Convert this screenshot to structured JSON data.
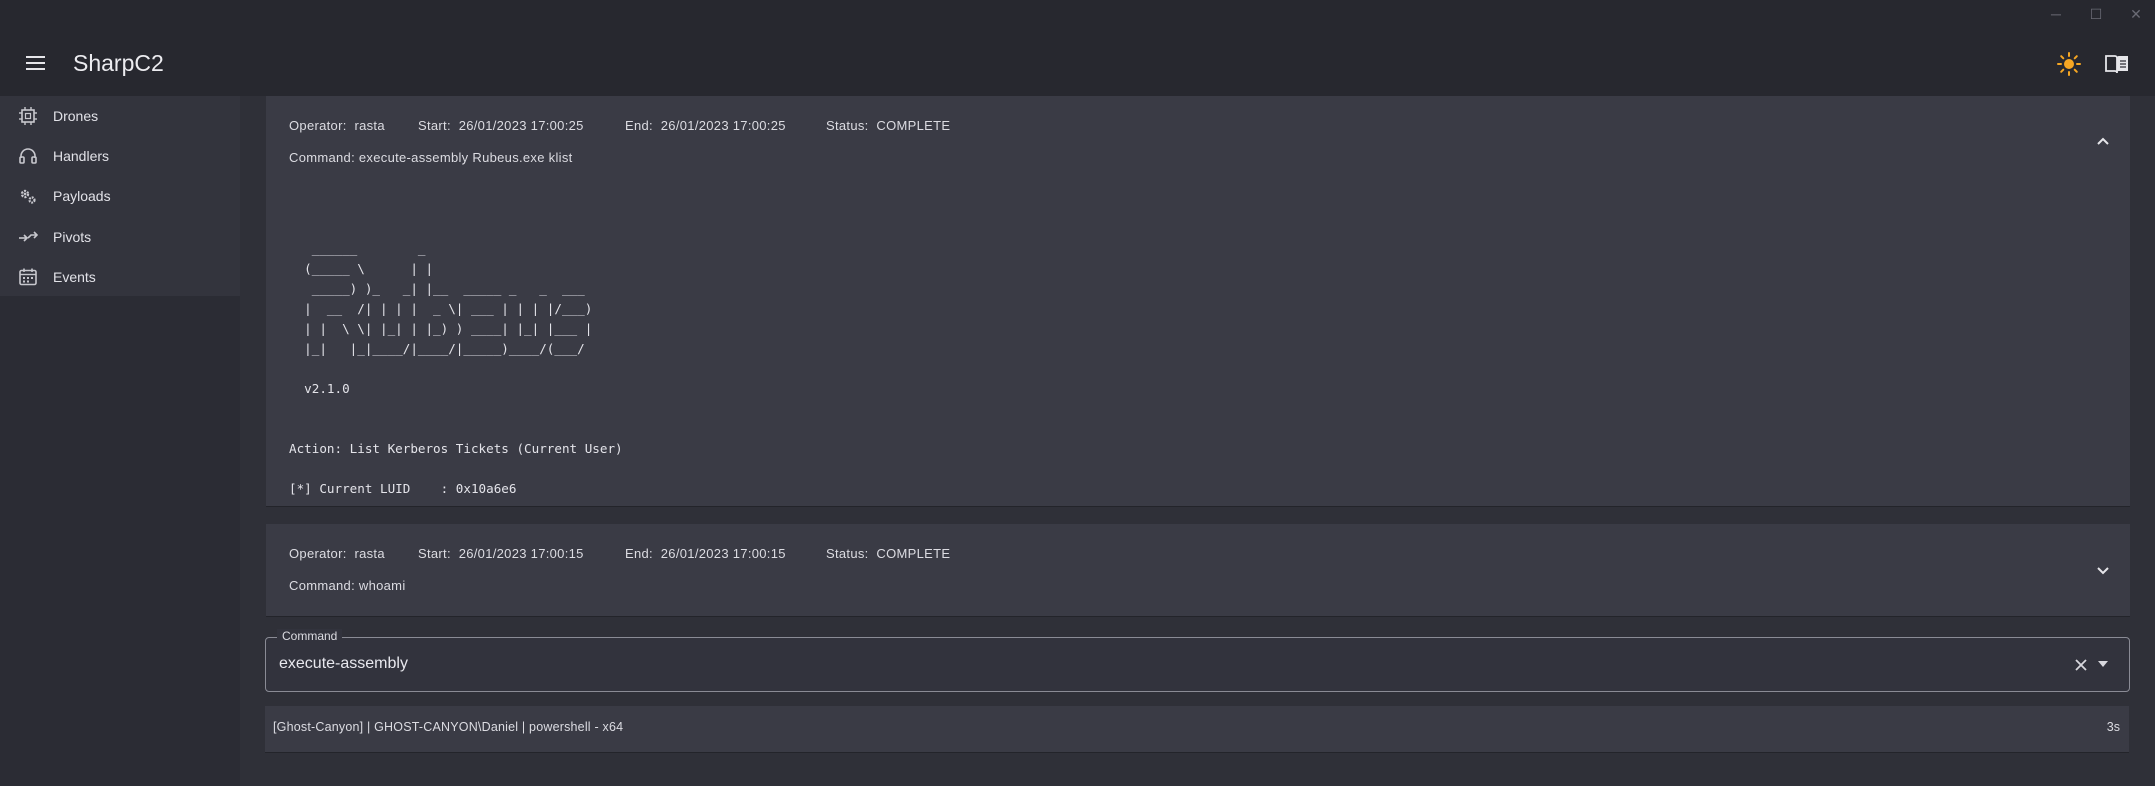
{
  "app": {
    "title": "SharpC2"
  },
  "sidebar": {
    "items": [
      {
        "label": "Drones",
        "icon": "chip-icon"
      },
      {
        "label": "Handlers",
        "icon": "headset-icon"
      },
      {
        "label": "Payloads",
        "icon": "gears-icon"
      },
      {
        "label": "Pivots",
        "icon": "pivot-icon"
      },
      {
        "label": "Events",
        "icon": "calendar-icon"
      }
    ]
  },
  "tasks": [
    {
      "operator_label": "Operator:",
      "operator": "rasta",
      "start_label": "Start:",
      "start": "26/01/2023 17:00:25",
      "end_label": "End:",
      "end": "26/01/2023 17:00:25",
      "status_label": "Status:",
      "status": "COMPLETE",
      "command_label": "Command:",
      "command": "execute-assembly Rubeus.exe klist",
      "expanded": true,
      "output": "\n\n   ______        _\n  (_____ \\      | |\n   _____) )_   _| |__  _____ _   _  ___\n  |  __  /| | | |  _ \\| ___ | | | |/___)\n  | |  \\ \\| |_| | |_) ) ____| |_| |___ |\n  |_|   |_|____/|____/|_____)____/(___/\n\n  v2.1.0\n\n\nAction: List Kerberos Tickets (Current User)\n\n[*] Current LUID    : 0x10a6e6"
    },
    {
      "operator_label": "Operator:",
      "operator": "rasta",
      "start_label": "Start:",
      "start": "26/01/2023 17:00:15",
      "end_label": "End:",
      "end": "26/01/2023 17:00:15",
      "status_label": "Status:",
      "status": "COMPLETE",
      "command_label": "Command:",
      "command": "whoami",
      "expanded": false
    }
  ],
  "command_input": {
    "label": "Command",
    "value": "execute-assembly"
  },
  "statusbar": {
    "session": "[Ghost-Canyon] | GHOST-CANYON\\Daniel | powershell - x64",
    "last_seen": "3s"
  },
  "colors": {
    "accent_sun": "#f5a623",
    "background": "#2f3038",
    "panel": "#3a3b45"
  }
}
